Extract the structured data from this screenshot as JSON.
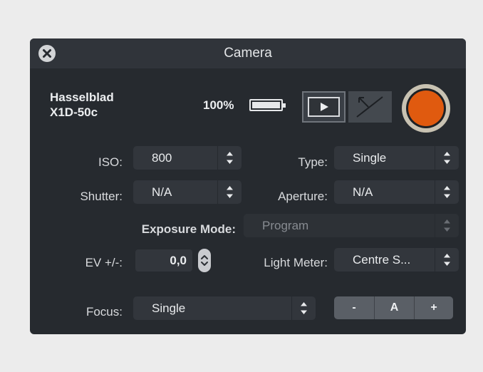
{
  "window": {
    "title": "Camera"
  },
  "camera": {
    "model_line1": "Hasselblad",
    "model_line2": "X1D-50c"
  },
  "battery": {
    "percent_label": "100%",
    "level": 1.0
  },
  "record": {
    "color": "#e05a0f"
  },
  "settings": {
    "iso": {
      "label": "ISO:",
      "value": "800"
    },
    "type": {
      "label": "Type:",
      "value": "Single"
    },
    "shutter": {
      "label": "Shutter:",
      "value": "N/A"
    },
    "aperture": {
      "label": "Aperture:",
      "value": "N/A"
    },
    "exposure_mode": {
      "label": "Exposure Mode:",
      "value": "Program"
    },
    "ev": {
      "label": "EV +/-:",
      "value": "0,0"
    },
    "light_meter": {
      "label": "Light Meter:",
      "value": "Centre S..."
    },
    "focus": {
      "label": "Focus:",
      "value": "Single"
    }
  },
  "focus_controls": {
    "minus": "-",
    "auto": "A",
    "plus": "+"
  },
  "icons": {
    "close": "close-icon",
    "battery": "battery-icon",
    "live_view": "play-icon",
    "fullscreen": "expand-icon",
    "stepper": "chevron-up-down-icon"
  }
}
